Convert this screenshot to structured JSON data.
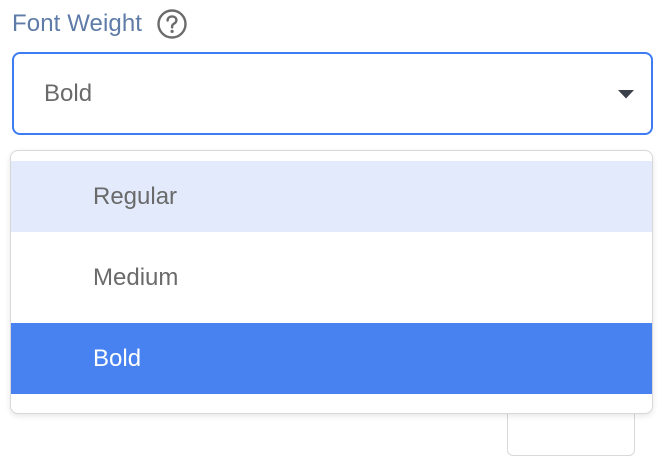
{
  "field": {
    "label": "Font Weight",
    "help_icon": "question-circle-icon",
    "selected_value": "Bold",
    "caret_icon": "caret-down-icon"
  },
  "dropdown": {
    "options": [
      {
        "label": "Regular",
        "state": "hovered"
      },
      {
        "label": "Medium",
        "state": "normal"
      },
      {
        "label": "Bold",
        "state": "selected"
      }
    ]
  },
  "colors": {
    "label": "#5f7ba8",
    "focus_border": "#3d7cf3",
    "hover_bg": "#e2eafb",
    "selected_bg": "#4782f0",
    "text": "#6a6a6a"
  }
}
